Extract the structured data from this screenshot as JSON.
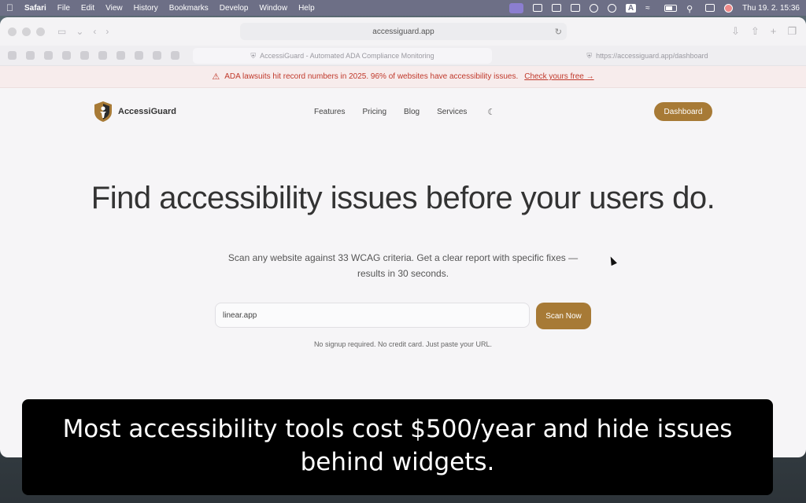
{
  "menubar": {
    "items": [
      "Safari",
      "File",
      "Edit",
      "View",
      "History",
      "Bookmarks",
      "Develop",
      "Window",
      "Help"
    ],
    "status_letter": "A",
    "clock": "Thu 19. 2.  15:36"
  },
  "browser": {
    "address": "accessiguard.app",
    "tabs": [
      {
        "label": "AccessiGuard - Automated ADA Compliance Monitoring"
      },
      {
        "label": "https://accessiguard.app/dashboard"
      }
    ]
  },
  "banner": {
    "text": "ADA lawsuits hit record numbers in 2025. 96% of websites have accessibility issues.",
    "cta": "Check yours free →"
  },
  "nav": {
    "brand": "AccessiGuard",
    "links": [
      "Features",
      "Pricing",
      "Blog",
      "Services"
    ],
    "dashboard_label": "Dashboard"
  },
  "hero": {
    "title": "Find accessibility issues before your users do.",
    "subtitle_line1": "Scan any website against 33 WCAG criteria. Get a clear report with specific fixes —",
    "subtitle_line2": "results in 30 seconds.",
    "input_value": "linear.app",
    "scan_label": "Scan Now",
    "hint": "No signup required. No credit card. Just paste your URL."
  },
  "caption": {
    "line1": "Most accessibility tools cost $500/year and hide issues",
    "line2": "behind widgets."
  },
  "colors": {
    "accent": "#a77a36",
    "banner_text": "#c0392b",
    "menubar": "#6d6f86"
  }
}
